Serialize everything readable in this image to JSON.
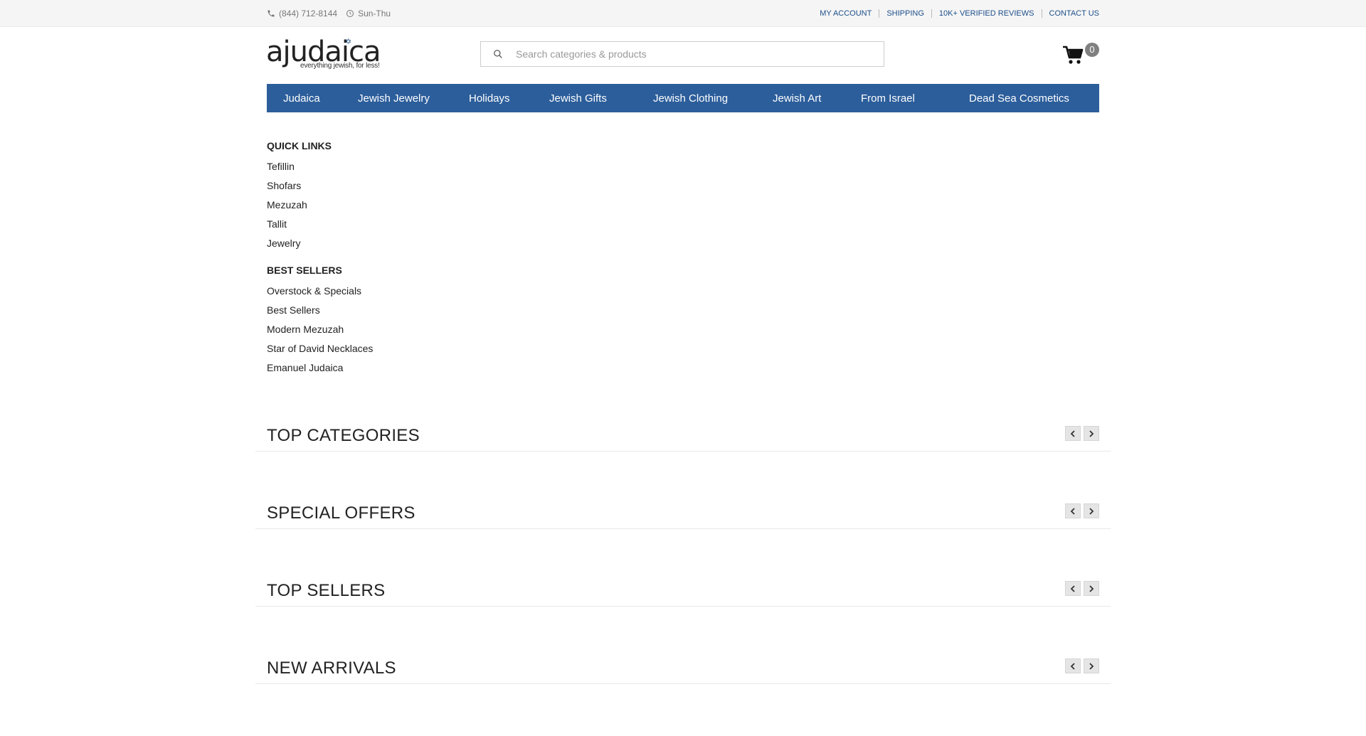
{
  "topbar": {
    "phone": "(844) 712-8144",
    "hours": "Sun-Thu",
    "links": [
      "MY ACCOUNT",
      "SHIPPING",
      "10K+ VERIFIED REVIEWS",
      "CONTACT US"
    ]
  },
  "logo": {
    "wordmark": "ajudaica",
    "tagline": "everything jewish, for less!"
  },
  "search": {
    "placeholder": "Search categories & products",
    "value": ""
  },
  "cart": {
    "count": "0"
  },
  "nav": {
    "items": [
      "Judaica",
      "Jewish Jewelry",
      "Holidays",
      "Jewish Gifts",
      "Jewish Clothing",
      "Jewish Art",
      "From Israel",
      "Dead Sea Cosmetics"
    ]
  },
  "quick_links": {
    "title": "QUICK LINKS",
    "items": [
      "Tefillin",
      "Shofars",
      "Mezuzah",
      "Tallit",
      "Jewelry"
    ]
  },
  "best_sellers": {
    "title": "BEST SELLERS",
    "items": [
      "Overstock & Specials",
      "Best Sellers",
      "Modern Mezuzah",
      "Star of David Necklaces",
      "Emanuel Judaica"
    ]
  },
  "sections": [
    "TOP CATEGORIES",
    "SPECIAL OFFERS",
    "TOP SELLERS",
    "NEW ARRIVALS"
  ],
  "colors": {
    "nav_bg": "#2c5e9b",
    "link": "#1d4f8a",
    "badge": "#808080"
  }
}
